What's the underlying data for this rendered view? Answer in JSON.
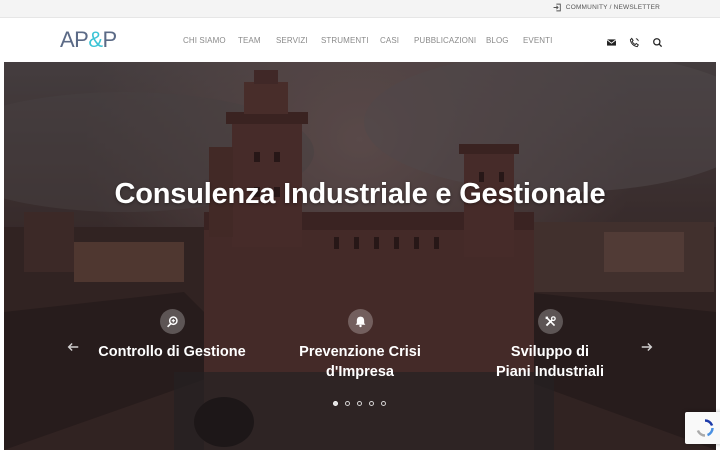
{
  "topbar": {
    "community_label": "COMMUNITY / NEWSLETTER",
    "icon": "sign-in-icon"
  },
  "header": {
    "logo": {
      "left": "AP",
      "amp": "&",
      "right": "P"
    },
    "nav": [
      {
        "label": "CHI SIAMO"
      },
      {
        "label": "TEAM"
      },
      {
        "label": "SERVIZI"
      },
      {
        "label": "STRUMENTI"
      },
      {
        "label": "CASI"
      },
      {
        "label": "PUBBLICAZIONI"
      },
      {
        "label": "BLOG"
      },
      {
        "label": "EVENTI"
      }
    ],
    "icons": [
      "mail-icon",
      "phone-icon",
      "search-icon"
    ]
  },
  "hero": {
    "title": "Consulenza Industriale e Gestionale",
    "features": [
      {
        "label_line1": "Controllo di Gestione",
        "label_line2": "",
        "icon": "magnifier-plus-icon"
      },
      {
        "label_line1": "Prevenzione Crisi",
        "label_line2": "d'Impresa",
        "icon": "bell-icon"
      },
      {
        "label_line1": "Sviluppo di",
        "label_line2": "Piani Industriali",
        "icon": "tools-icon"
      }
    ],
    "slider": {
      "total_slides": 5,
      "active_index": 0
    }
  },
  "colors": {
    "logo_text": "#5b6a86",
    "logo_accent": "#3cc4d6",
    "nav_text": "#8a8a8a",
    "hero_text": "#ffffff"
  }
}
